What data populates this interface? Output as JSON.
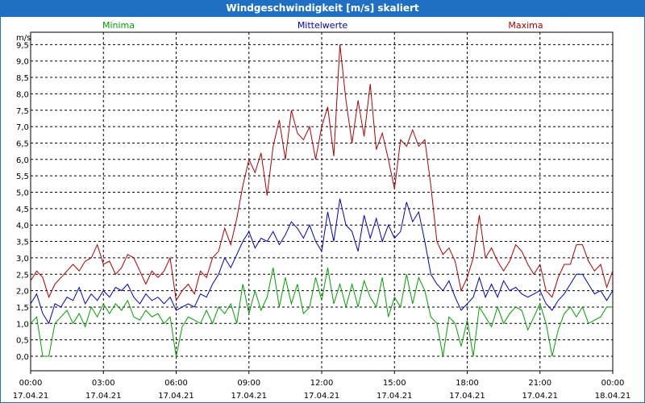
{
  "chart_data": {
    "type": "line",
    "title": "Windgeschwindigkeit [m/s] skaliert",
    "ylabel": "m/s",
    "ylim": [
      0,
      9.5
    ],
    "yticks": [
      "0,0",
      "0,5",
      "1,0",
      "1,5",
      "2,0",
      "2,5",
      "3,0",
      "3,5",
      "4,0",
      "4,5",
      "5,0",
      "5,5",
      "6,0",
      "6,5",
      "7,0",
      "7,5",
      "8,0",
      "8,5",
      "9,0",
      "9,5"
    ],
    "xlim_hours": [
      0,
      24
    ],
    "xticks": [
      {
        "hour": 0,
        "time": "00:00",
        "date": "17.04.21"
      },
      {
        "hour": 3,
        "time": "03:00",
        "date": "17.04.21"
      },
      {
        "hour": 6,
        "time": "06:00",
        "date": "17.04.21"
      },
      {
        "hour": 9,
        "time": "09:00",
        "date": "17.04.21"
      },
      {
        "hour": 12,
        "time": "12:00",
        "date": "17.04.21"
      },
      {
        "hour": 15,
        "time": "15:00",
        "date": "17.04.21"
      },
      {
        "hour": 18,
        "time": "18:00",
        "date": "17.04.21"
      },
      {
        "hour": 21,
        "time": "21:00",
        "date": "17.04.21"
      },
      {
        "hour": 24,
        "time": "00:00",
        "date": "18.04.21"
      }
    ],
    "grid": true,
    "legend_position": "top",
    "series": [
      {
        "name": "Minima",
        "color": "#00a000",
        "points": [
          [
            0.0,
            1.0
          ],
          [
            0.25,
            1.2
          ],
          [
            0.5,
            0.0
          ],
          [
            0.75,
            0.0
          ],
          [
            1.0,
            1.0
          ],
          [
            1.25,
            1.2
          ],
          [
            1.5,
            1.4
          ],
          [
            1.75,
            1.0
          ],
          [
            2.0,
            1.3
          ],
          [
            2.25,
            0.9
          ],
          [
            2.5,
            1.5
          ],
          [
            2.75,
            1.2
          ],
          [
            3.0,
            1.6
          ],
          [
            3.25,
            1.3
          ],
          [
            3.5,
            1.6
          ],
          [
            3.75,
            1.4
          ],
          [
            4.0,
            1.7
          ],
          [
            4.25,
            1.2
          ],
          [
            4.5,
            1.1
          ],
          [
            4.75,
            1.4
          ],
          [
            5.0,
            1.2
          ],
          [
            5.25,
            1.3
          ],
          [
            5.5,
            1.0
          ],
          [
            5.75,
            1.2
          ],
          [
            6.0,
            0.0
          ],
          [
            6.25,
            0.9
          ],
          [
            6.5,
            1.2
          ],
          [
            6.75,
            1.1
          ],
          [
            7.0,
            1.0
          ],
          [
            7.25,
            1.4
          ],
          [
            7.5,
            1.0
          ],
          [
            7.75,
            1.5
          ],
          [
            8.0,
            1.3
          ],
          [
            8.25,
            1.6
          ],
          [
            8.5,
            1.0
          ],
          [
            8.75,
            2.2
          ],
          [
            9.0,
            1.3
          ],
          [
            9.25,
            2.0
          ],
          [
            9.5,
            1.4
          ],
          [
            9.75,
            1.8
          ],
          [
            10.0,
            2.7
          ],
          [
            10.25,
            1.5
          ],
          [
            10.5,
            2.4
          ],
          [
            10.75,
            1.6
          ],
          [
            11.0,
            2.2
          ],
          [
            11.25,
            1.3
          ],
          [
            11.5,
            1.5
          ],
          [
            11.75,
            2.4
          ],
          [
            12.0,
            1.7
          ],
          [
            12.25,
            2.7
          ],
          [
            12.5,
            1.6
          ],
          [
            12.75,
            2.2
          ],
          [
            13.0,
            1.5
          ],
          [
            13.25,
            2.2
          ],
          [
            13.5,
            1.5
          ],
          [
            13.75,
            2.3
          ],
          [
            14.0,
            1.8
          ],
          [
            14.25,
            1.5
          ],
          [
            14.5,
            2.4
          ],
          [
            14.75,
            1.2
          ],
          [
            15.0,
            1.8
          ],
          [
            15.25,
            1.5
          ],
          [
            15.5,
            2.5
          ],
          [
            15.75,
            1.6
          ],
          [
            16.0,
            2.4
          ],
          [
            16.25,
            2.0
          ],
          [
            16.5,
            1.2
          ],
          [
            16.75,
            1.0
          ],
          [
            17.0,
            0.0
          ],
          [
            17.25,
            1.2
          ],
          [
            17.5,
            1.0
          ],
          [
            17.75,
            0.3
          ],
          [
            18.0,
            1.1
          ],
          [
            18.25,
            0.0
          ],
          [
            18.5,
            1.5
          ],
          [
            18.75,
            1.2
          ],
          [
            19.0,
            0.9
          ],
          [
            19.25,
            1.5
          ],
          [
            19.5,
            1.0
          ],
          [
            19.75,
            1.3
          ],
          [
            20.0,
            1.5
          ],
          [
            20.25,
            1.4
          ],
          [
            20.5,
            0.8
          ],
          [
            20.75,
            1.2
          ],
          [
            21.0,
            1.6
          ],
          [
            21.25,
            1.0
          ],
          [
            21.5,
            0.0
          ],
          [
            21.75,
            0.8
          ],
          [
            22.0,
            1.3
          ],
          [
            22.25,
            1.5
          ],
          [
            22.5,
            1.2
          ],
          [
            22.75,
            1.5
          ],
          [
            23.0,
            1.0
          ],
          [
            23.25,
            1.1
          ],
          [
            23.5,
            1.2
          ],
          [
            23.75,
            1.5
          ],
          [
            24.0,
            1.5
          ]
        ]
      },
      {
        "name": "Mittelwerte",
        "color": "#0000c0",
        "points": [
          [
            0.0,
            1.6
          ],
          [
            0.25,
            1.9
          ],
          [
            0.5,
            1.3
          ],
          [
            0.75,
            1.0
          ],
          [
            1.0,
            1.6
          ],
          [
            1.25,
            1.5
          ],
          [
            1.5,
            1.8
          ],
          [
            1.75,
            1.7
          ],
          [
            2.0,
            2.1
          ],
          [
            2.25,
            1.6
          ],
          [
            2.5,
            1.9
          ],
          [
            2.75,
            1.7
          ],
          [
            3.0,
            2.0
          ],
          [
            3.25,
            1.8
          ],
          [
            3.5,
            2.1
          ],
          [
            3.75,
            2.0
          ],
          [
            4.0,
            2.2
          ],
          [
            4.25,
            1.8
          ],
          [
            4.5,
            1.6
          ],
          [
            4.75,
            1.9
          ],
          [
            5.0,
            1.7
          ],
          [
            5.25,
            1.8
          ],
          [
            5.5,
            1.6
          ],
          [
            5.75,
            1.8
          ],
          [
            6.0,
            1.4
          ],
          [
            6.25,
            1.5
          ],
          [
            6.5,
            1.6
          ],
          [
            6.75,
            1.5
          ],
          [
            7.0,
            1.9
          ],
          [
            7.25,
            1.8
          ],
          [
            7.5,
            2.2
          ],
          [
            7.75,
            2.5
          ],
          [
            8.0,
            3.0
          ],
          [
            8.25,
            2.7
          ],
          [
            8.5,
            3.1
          ],
          [
            8.75,
            3.5
          ],
          [
            9.0,
            3.8
          ],
          [
            9.25,
            3.3
          ],
          [
            9.5,
            3.6
          ],
          [
            9.75,
            3.5
          ],
          [
            10.0,
            3.8
          ],
          [
            10.25,
            3.4
          ],
          [
            10.5,
            3.7
          ],
          [
            10.75,
            4.1
          ],
          [
            11.0,
            3.9
          ],
          [
            11.25,
            3.6
          ],
          [
            11.5,
            4.0
          ],
          [
            11.75,
            3.5
          ],
          [
            12.0,
            3.2
          ],
          [
            12.25,
            4.4
          ],
          [
            12.5,
            3.5
          ],
          [
            12.75,
            4.8
          ],
          [
            13.0,
            4.0
          ],
          [
            13.25,
            3.8
          ],
          [
            13.5,
            3.2
          ],
          [
            13.75,
            4.3
          ],
          [
            14.0,
            3.6
          ],
          [
            14.25,
            4.2
          ],
          [
            14.5,
            3.5
          ],
          [
            14.75,
            4.0
          ],
          [
            15.0,
            3.6
          ],
          [
            15.25,
            3.8
          ],
          [
            15.5,
            4.7
          ],
          [
            15.75,
            4.1
          ],
          [
            16.0,
            4.4
          ],
          [
            16.25,
            3.5
          ],
          [
            16.5,
            2.5
          ],
          [
            16.75,
            2.2
          ],
          [
            17.0,
            2.0
          ],
          [
            17.25,
            2.3
          ],
          [
            17.5,
            1.8
          ],
          [
            17.75,
            1.4
          ],
          [
            18.0,
            1.6
          ],
          [
            18.25,
            1.8
          ],
          [
            18.5,
            2.4
          ],
          [
            18.75,
            1.8
          ],
          [
            19.0,
            2.2
          ],
          [
            19.25,
            1.8
          ],
          [
            19.5,
            2.3
          ],
          [
            19.75,
            2.0
          ],
          [
            20.0,
            2.1
          ],
          [
            20.25,
            1.9
          ],
          [
            20.5,
            1.8
          ],
          [
            20.75,
            1.9
          ],
          [
            21.0,
            2.0
          ],
          [
            21.25,
            1.6
          ],
          [
            21.5,
            1.4
          ],
          [
            21.75,
            1.7
          ],
          [
            22.0,
            1.9
          ],
          [
            22.25,
            2.2
          ],
          [
            22.5,
            2.5
          ],
          [
            22.75,
            2.5
          ],
          [
            23.0,
            2.2
          ],
          [
            23.25,
            1.9
          ],
          [
            23.5,
            2.0
          ],
          [
            23.75,
            1.7
          ],
          [
            24.0,
            2.0
          ]
        ]
      },
      {
        "name": "Maxima",
        "color": "#b00000",
        "points": [
          [
            0.0,
            2.3
          ],
          [
            0.25,
            2.6
          ],
          [
            0.5,
            2.4
          ],
          [
            0.75,
            1.8
          ],
          [
            1.0,
            2.2
          ],
          [
            1.25,
            2.4
          ],
          [
            1.5,
            2.6
          ],
          [
            1.75,
            2.8
          ],
          [
            2.0,
            2.6
          ],
          [
            2.25,
            2.9
          ],
          [
            2.5,
            3.0
          ],
          [
            2.75,
            3.4
          ],
          [
            3.0,
            2.8
          ],
          [
            3.25,
            2.9
          ],
          [
            3.5,
            2.5
          ],
          [
            3.75,
            2.7
          ],
          [
            4.0,
            3.1
          ],
          [
            4.25,
            3.0
          ],
          [
            4.5,
            2.6
          ],
          [
            4.75,
            2.2
          ],
          [
            5.0,
            2.6
          ],
          [
            5.25,
            2.4
          ],
          [
            5.5,
            2.6
          ],
          [
            5.75,
            3.0
          ],
          [
            6.0,
            1.7
          ],
          [
            6.25,
            2.0
          ],
          [
            6.5,
            2.2
          ],
          [
            6.75,
            1.9
          ],
          [
            7.0,
            2.6
          ],
          [
            7.25,
            2.4
          ],
          [
            7.5,
            3.0
          ],
          [
            7.75,
            3.2
          ],
          [
            8.0,
            3.9
          ],
          [
            8.25,
            3.4
          ],
          [
            8.5,
            4.2
          ],
          [
            8.75,
            5.2
          ],
          [
            9.0,
            6.0
          ],
          [
            9.25,
            5.6
          ],
          [
            9.5,
            6.2
          ],
          [
            9.75,
            4.9
          ],
          [
            10.0,
            6.4
          ],
          [
            10.25,
            7.2
          ],
          [
            10.5,
            6.0
          ],
          [
            10.75,
            7.5
          ],
          [
            11.0,
            6.8
          ],
          [
            11.25,
            6.6
          ],
          [
            11.5,
            7.0
          ],
          [
            11.75,
            6.0
          ],
          [
            12.0,
            7.0
          ],
          [
            12.25,
            7.6
          ],
          [
            12.5,
            6.1
          ],
          [
            12.75,
            9.5
          ],
          [
            13.0,
            7.8
          ],
          [
            13.25,
            6.5
          ],
          [
            13.5,
            7.8
          ],
          [
            13.75,
            6.7
          ],
          [
            14.0,
            8.3
          ],
          [
            14.25,
            6.3
          ],
          [
            14.5,
            6.8
          ],
          [
            14.75,
            6.0
          ],
          [
            15.0,
            5.1
          ],
          [
            15.25,
            6.6
          ],
          [
            15.5,
            6.4
          ],
          [
            15.75,
            6.9
          ],
          [
            16.0,
            6.4
          ],
          [
            16.25,
            6.6
          ],
          [
            16.5,
            5.2
          ],
          [
            16.75,
            3.5
          ],
          [
            17.0,
            3.1
          ],
          [
            17.25,
            3.3
          ],
          [
            17.5,
            2.9
          ],
          [
            17.75,
            2.0
          ],
          [
            18.0,
            2.4
          ],
          [
            18.25,
            3.0
          ],
          [
            18.5,
            4.3
          ],
          [
            18.75,
            3.0
          ],
          [
            19.0,
            3.3
          ],
          [
            19.25,
            2.9
          ],
          [
            19.5,
            2.6
          ],
          [
            19.75,
            2.9
          ],
          [
            20.0,
            3.4
          ],
          [
            20.25,
            3.2
          ],
          [
            20.5,
            2.8
          ],
          [
            20.75,
            2.5
          ],
          [
            21.0,
            2.8
          ],
          [
            21.25,
            2.0
          ],
          [
            21.5,
            1.8
          ],
          [
            21.75,
            2.4
          ],
          [
            22.0,
            2.8
          ],
          [
            22.25,
            2.8
          ],
          [
            22.5,
            3.4
          ],
          [
            22.75,
            3.4
          ],
          [
            23.0,
            2.9
          ],
          [
            23.25,
            2.6
          ],
          [
            23.5,
            2.8
          ],
          [
            23.75,
            2.1
          ],
          [
            24.0,
            2.6
          ]
        ]
      }
    ]
  }
}
